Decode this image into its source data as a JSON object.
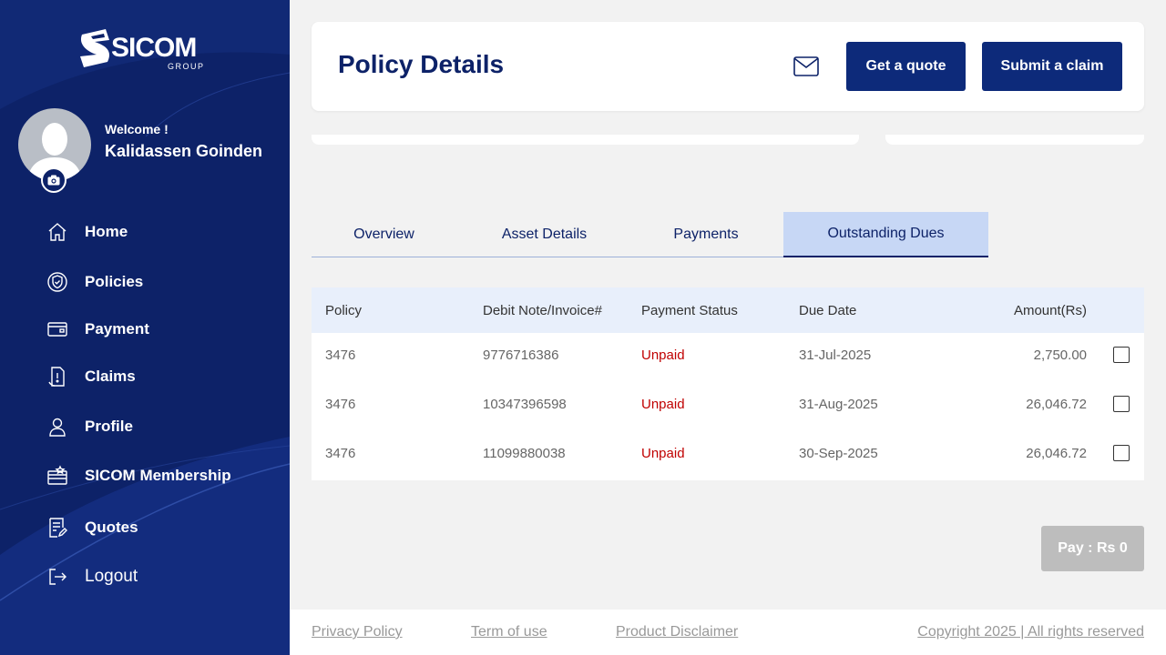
{
  "brand": {
    "name": "SICOM",
    "sub": "GROUP"
  },
  "user": {
    "welcome": "Welcome !",
    "name": "Kalidassen Goinden"
  },
  "sidebar": {
    "items": [
      {
        "label": "Home",
        "icon": "home-icon"
      },
      {
        "label": "Policies",
        "icon": "shield-check-icon"
      },
      {
        "label": "Payment",
        "icon": "card-icon"
      },
      {
        "label": "Claims",
        "icon": "claim-doc-icon"
      },
      {
        "label": "Profile",
        "icon": "user-icon"
      },
      {
        "label": "SICOM Membership",
        "icon": "membership-icon"
      },
      {
        "label": "Quotes",
        "icon": "quote-doc-icon"
      },
      {
        "label": "Logout",
        "icon": "logout-icon"
      }
    ]
  },
  "header": {
    "title": "Policy Details",
    "quote_label": "Get a quote",
    "claim_label": "Submit a claim"
  },
  "tabs": [
    {
      "label": "Overview",
      "active": false
    },
    {
      "label": "Asset Details",
      "active": false
    },
    {
      "label": "Payments",
      "active": false
    },
    {
      "label": "Outstanding Dues",
      "active": true
    }
  ],
  "table": {
    "columns": [
      "Policy",
      "Debit Note/Invoice#",
      "Payment Status",
      "Due Date",
      "Amount(Rs)"
    ],
    "rows": [
      {
        "policy": "3476",
        "invoice": "9776716386",
        "status": "Unpaid",
        "due": "31-Jul-2025",
        "amount": "2,750.00",
        "checked": false
      },
      {
        "policy": "3476",
        "invoice": "10347396598",
        "status": "Unpaid",
        "due": "31-Aug-2025",
        "amount": "26,046.72",
        "checked": false
      },
      {
        "policy": "3476",
        "invoice": "11099880038",
        "status": "Unpaid",
        "due": "30-Sep-2025",
        "amount": "26,046.72",
        "checked": false
      }
    ]
  },
  "pay_button": {
    "label": "Pay : Rs 0"
  },
  "footer": {
    "privacy": "Privacy Policy",
    "terms": "Term of use",
    "disclaimer": "Product Disclaimer",
    "copyright": "Copyright 2025 | All rights reserved"
  },
  "colors": {
    "sidebar": "#0d2268",
    "primary": "#0d2a7a",
    "active_tab": "#c7d7f5",
    "unpaid": "#c00000"
  }
}
